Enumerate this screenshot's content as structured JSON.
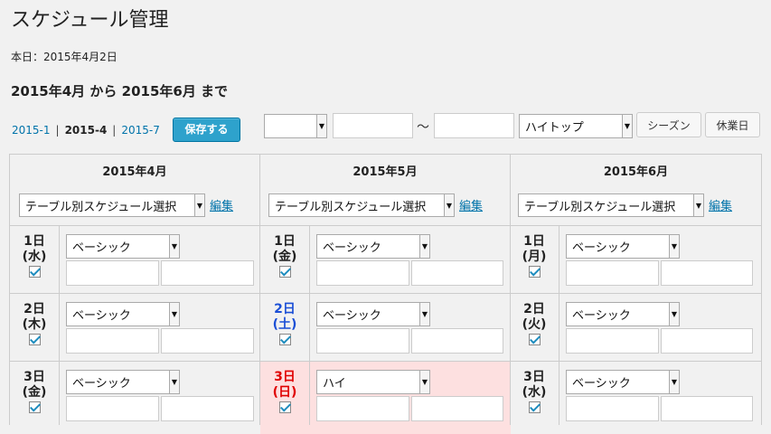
{
  "page_title": "スケジュール管理",
  "today": "本日：2015年4月2日",
  "range_heading": "2015年4月 から 2015年6月 まで",
  "pager": {
    "prev": "2015-1",
    "current": "2015-4",
    "next": "2015-7",
    "sep": "|"
  },
  "save_label": "保存する",
  "filter": {
    "select1_value": "",
    "input1_value": "",
    "tilde": "〜",
    "input2_value": "",
    "type_value": "ハイトップ",
    "season_label": "シーズン",
    "holiday_label": "休業日"
  },
  "colors": {
    "accent": "#2ea2cc",
    "saturday": "#1b4fd6",
    "sunday": "#e00000",
    "sunday_bg": "#fde0e0"
  },
  "months": [
    {
      "title": "2015年4月",
      "table_select": "テーブル別スケジュール選択",
      "edit_label": "編集",
      "days": [
        {
          "day": "1日",
          "weekday": "(水)",
          "plan": "ベーシック",
          "checked": true
        },
        {
          "day": "2日",
          "weekday": "(木)",
          "plan": "ベーシック",
          "checked": true
        },
        {
          "day": "3日",
          "weekday": "(金)",
          "plan": "ベーシック",
          "checked": true
        }
      ]
    },
    {
      "title": "2015年5月",
      "table_select": "テーブル別スケジュール選択",
      "edit_label": "編集",
      "days": [
        {
          "day": "1日",
          "weekday": "(金)",
          "plan": "ベーシック",
          "checked": true
        },
        {
          "day": "2日",
          "weekday": "(土)",
          "plan": "ベーシック",
          "checked": true
        },
        {
          "day": "3日",
          "weekday": "(日)",
          "plan": "ハイ",
          "checked": true
        }
      ]
    },
    {
      "title": "2015年6月",
      "table_select": "テーブル別スケジュール選択",
      "edit_label": "編集",
      "days": [
        {
          "day": "1日",
          "weekday": "(月)",
          "plan": "ベーシック",
          "checked": true
        },
        {
          "day": "2日",
          "weekday": "(火)",
          "plan": "ベーシック",
          "checked": true
        },
        {
          "day": "3日",
          "weekday": "(水)",
          "plan": "ベーシック",
          "checked": true
        }
      ]
    }
  ]
}
